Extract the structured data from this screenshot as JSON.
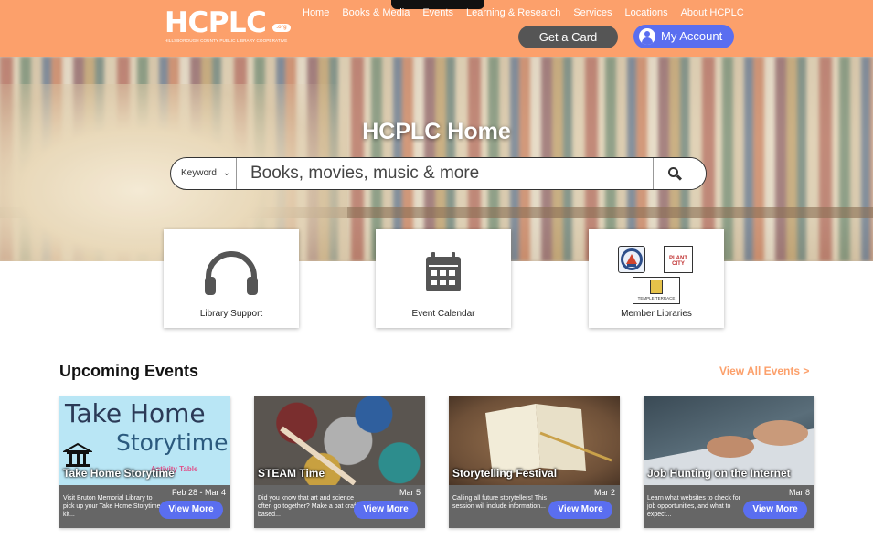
{
  "header": {
    "logo_text": "HCPLC",
    "logo_badge": ".org",
    "logo_subtitle": "HILLSBOROUGH COUNTY PUBLIC LIBRARY COOPERATIVE",
    "nav": [
      "Home",
      "Books & Media",
      "Events",
      "Learning & Research",
      "Services",
      "Locations",
      "About HCPLC"
    ],
    "get_card_label": "Get a Card",
    "account_label": "My Account"
  },
  "hero": {
    "title": "HCPLC Home",
    "search_type": "Keyword",
    "search_placeholder": "Books, movies, music & more"
  },
  "quick_links": [
    {
      "label": "Library Support",
      "icon": "headphones-icon"
    },
    {
      "label": "Event Calendar",
      "icon": "calendar-icon"
    },
    {
      "label": "Member Libraries",
      "icon": "member-library-seals"
    }
  ],
  "member_seals": [
    "PLANT CITY",
    "TEMPLE TERRACE"
  ],
  "events": {
    "title": "Upcoming Events",
    "view_all": "View All Events  >",
    "items": [
      {
        "title": "Take Home Storytime",
        "date": "Feb 28 - Mar 4",
        "desc": "Visit Bruton Memorial Library to pick up your Take Home Storytime kit...",
        "button": "View More",
        "image_line1": "Take Home",
        "image_line2": "Storytime",
        "image_sub": "Activity Table"
      },
      {
        "title": "STEAM Time",
        "date": "Mar 5",
        "desc": "Did you know that art and science often go together? Make a bat craft based...",
        "button": "View More"
      },
      {
        "title": "Storytelling Festival",
        "date": "Mar 2",
        "desc": "Calling all future storytellers! This session will include information...",
        "button": "View More"
      },
      {
        "title": "Job Hunting on the Internet",
        "date": "Mar 8",
        "desc": "Learn what websites to check for job opportunities, and what to expect...",
        "button": "View More"
      }
    ]
  },
  "colors": {
    "header": "#fca06b",
    "accent_blue": "#5a6ef0",
    "card_info": "#666666"
  }
}
